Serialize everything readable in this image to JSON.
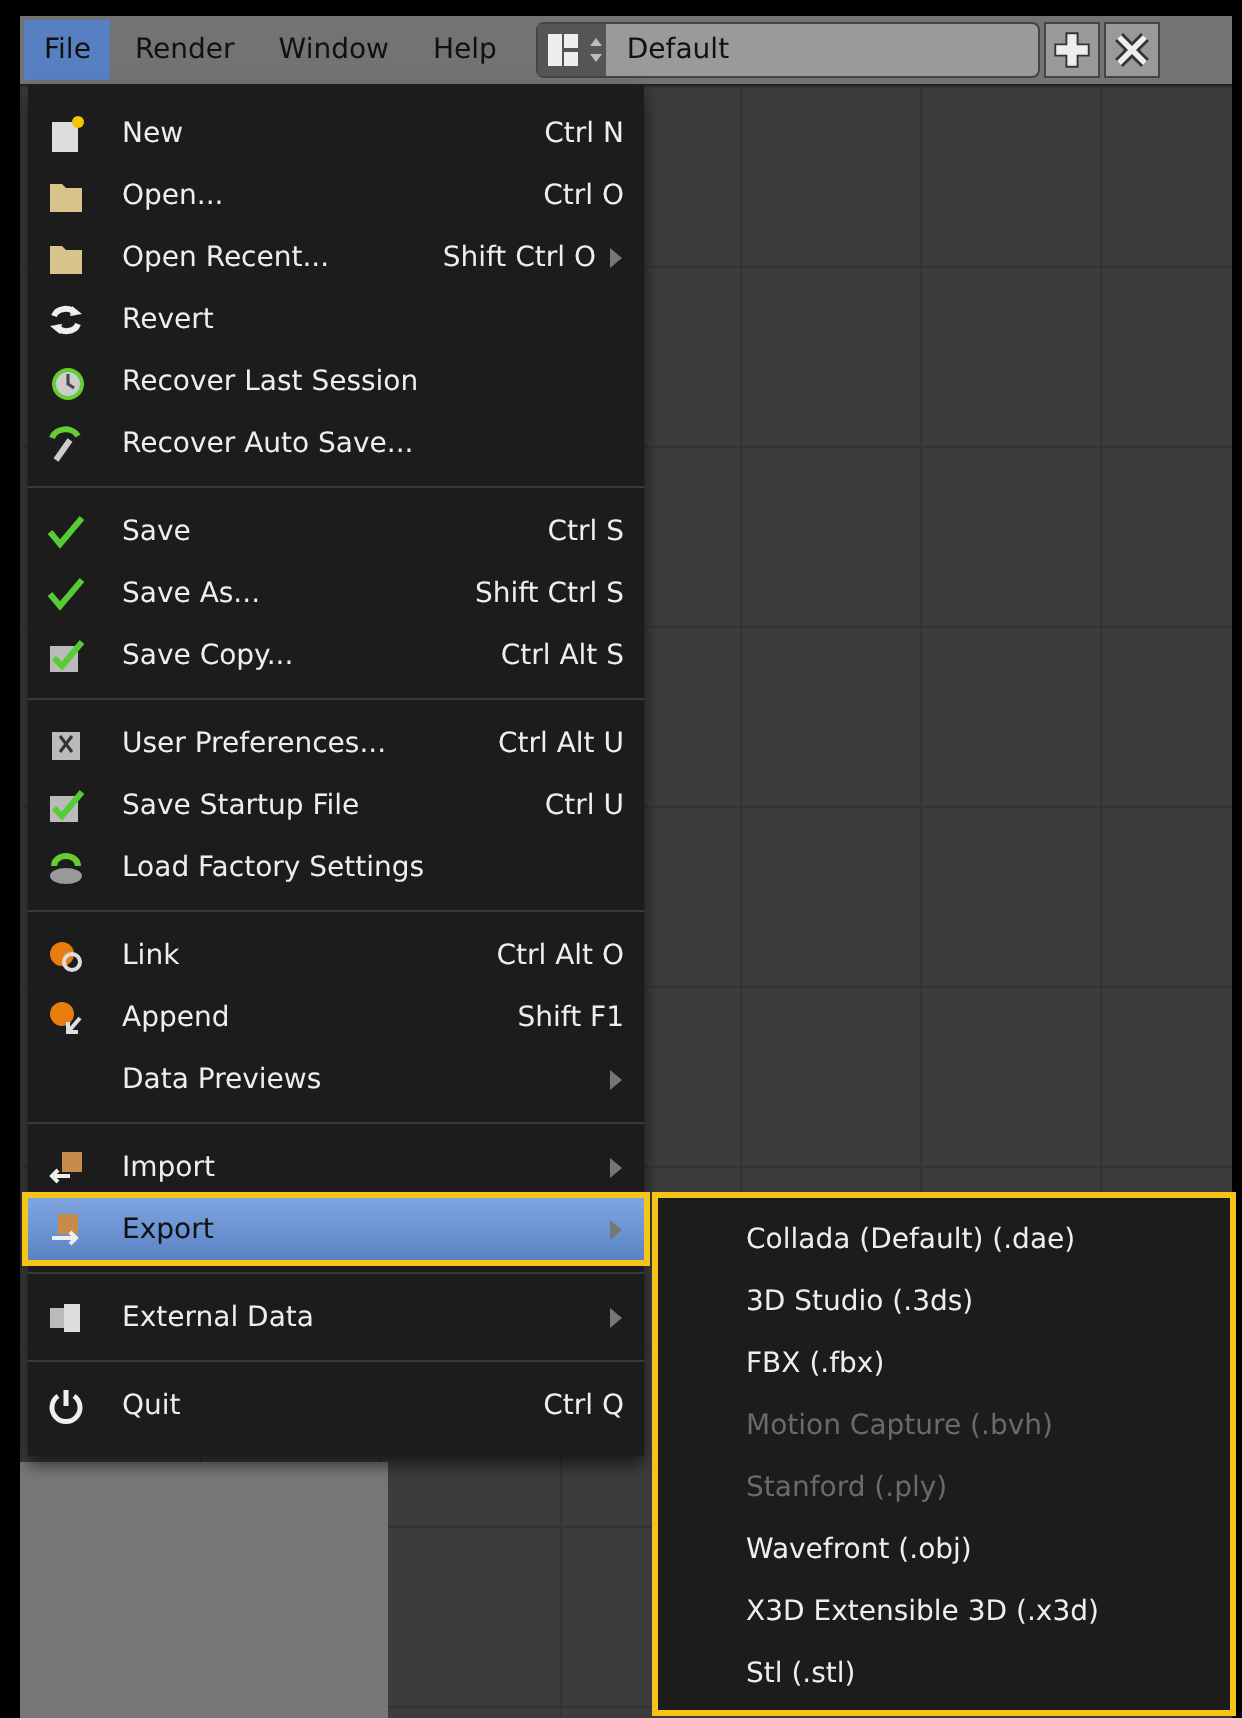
{
  "menubar": [
    {
      "label": "File",
      "selected": true
    },
    {
      "label": "Render",
      "selected": false
    },
    {
      "label": "Window",
      "selected": false
    },
    {
      "label": "Help",
      "selected": false
    }
  ],
  "layout_selector": {
    "value": "Default"
  },
  "file_menu": {
    "sections": [
      [
        {
          "label": "New",
          "shortcut": "Ctrl N",
          "submenu": false,
          "selected": false
        },
        {
          "label": "Open...",
          "shortcut": "Ctrl O",
          "submenu": false,
          "selected": false
        },
        {
          "label": "Open Recent...",
          "shortcut": "Shift Ctrl O",
          "submenu": true,
          "selected": false
        },
        {
          "label": "Revert",
          "submenu": false,
          "selected": false
        },
        {
          "label": "Recover Last Session",
          "submenu": false,
          "selected": false
        },
        {
          "label": "Recover Auto Save...",
          "submenu": false,
          "selected": false
        }
      ],
      [
        {
          "label": "Save",
          "shortcut": "Ctrl S",
          "submenu": false,
          "selected": false
        },
        {
          "label": "Save As...",
          "shortcut": "Shift Ctrl S",
          "submenu": false,
          "selected": false
        },
        {
          "label": "Save Copy...",
          "shortcut": "Ctrl Alt S",
          "submenu": false,
          "selected": false
        }
      ],
      [
        {
          "label": "User Preferences...",
          "shortcut": "Ctrl Alt U",
          "submenu": false,
          "selected": false
        },
        {
          "label": "Save Startup File",
          "shortcut": "Ctrl U",
          "submenu": false,
          "selected": false
        },
        {
          "label": "Load Factory Settings",
          "submenu": false,
          "selected": false
        }
      ],
      [
        {
          "label": "Link",
          "shortcut": "Ctrl Alt O",
          "submenu": false,
          "selected": false
        },
        {
          "label": "Append",
          "shortcut": "Shift F1",
          "submenu": false,
          "selected": false
        },
        {
          "label": "Data Previews",
          "submenu": true,
          "selected": false
        }
      ],
      [
        {
          "label": "Import",
          "submenu": true,
          "selected": false
        },
        {
          "label": "Export",
          "submenu": true,
          "selected": true
        }
      ],
      [
        {
          "label": "External Data",
          "submenu": true,
          "selected": false
        }
      ],
      [
        {
          "label": "Quit",
          "shortcut": "Ctrl Q",
          "submenu": false,
          "selected": false
        }
      ]
    ]
  },
  "export_submenu": {
    "items": [
      {
        "label": "Collada (Default) (.dae)",
        "disabled": false
      },
      {
        "label": "3D Studio (.3ds)",
        "disabled": false
      },
      {
        "label": "FBX (.fbx)",
        "disabled": false
      },
      {
        "label": "Motion Capture (.bvh)",
        "disabled": true
      },
      {
        "label": "Stanford (.ply)",
        "disabled": true
      },
      {
        "label": "Wavefront (.obj)",
        "disabled": false
      },
      {
        "label": "X3D Extensible 3D (.x3d)",
        "disabled": false
      },
      {
        "label": "Stl (.stl)",
        "disabled": false
      }
    ]
  }
}
